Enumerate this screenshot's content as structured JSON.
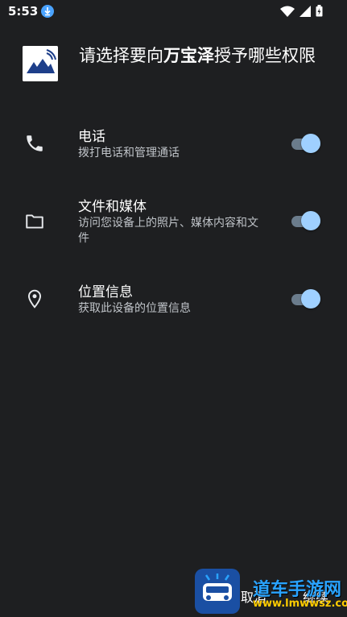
{
  "status_bar": {
    "time": "5:53",
    "icons": [
      "download-icon",
      "wifi-icon",
      "signal-icon",
      "battery-icon"
    ]
  },
  "header": {
    "title_prefix": "请选择要向",
    "app_name": "万宝泽",
    "title_suffix": "授予哪些权限"
  },
  "permissions": [
    {
      "icon": "phone-icon",
      "title": "电话",
      "description": "拨打电话和管理通话",
      "enabled": true
    },
    {
      "icon": "folder-icon",
      "title": "文件和媒体",
      "description": "访问您设备上的照片、媒体内容和文件",
      "enabled": true
    },
    {
      "icon": "location-icon",
      "title": "位置信息",
      "description": "获取此设备的位置信息",
      "enabled": true
    }
  ],
  "footer": {
    "cancel_label": "取消",
    "continue_label": "继续"
  },
  "watermark": {
    "name": "道车手游网",
    "url": "www.lmwwsz.com"
  },
  "colors": {
    "background": "#1e1f21",
    "toggle_thumb": "#9fd0ff",
    "toggle_track": "#6b7c8c",
    "secondary_text": "#bfc3c8"
  }
}
